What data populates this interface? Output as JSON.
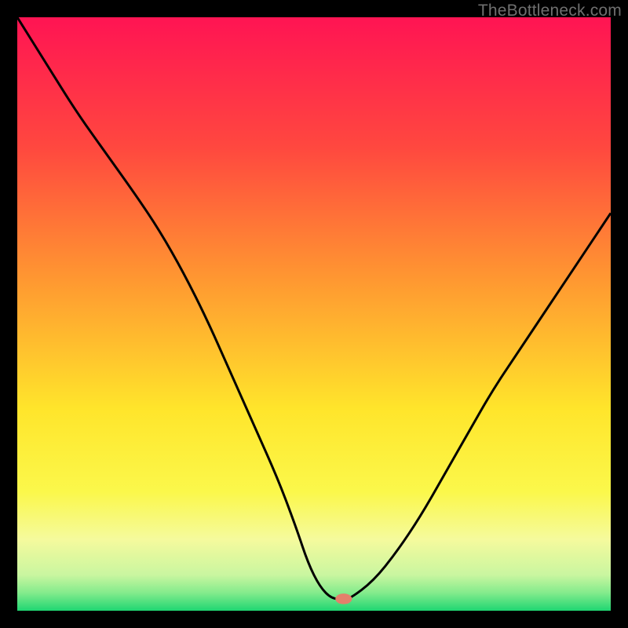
{
  "watermark": "TheBottleneck.com",
  "chart_data": {
    "type": "line",
    "title": "",
    "xlabel": "",
    "ylabel": "",
    "xlim": [
      0,
      100
    ],
    "ylim": [
      0,
      100
    ],
    "grid": false,
    "legend": false,
    "background_gradient": {
      "stops": [
        {
          "pct": 0,
          "color": "#ff1453"
        },
        {
          "pct": 22,
          "color": "#ff483f"
        },
        {
          "pct": 44,
          "color": "#ff9731"
        },
        {
          "pct": 66,
          "color": "#ffe52b"
        },
        {
          "pct": 80,
          "color": "#fbf84b"
        },
        {
          "pct": 88,
          "color": "#f5fa9d"
        },
        {
          "pct": 94,
          "color": "#c9f6a0"
        },
        {
          "pct": 97,
          "color": "#83eb8c"
        },
        {
          "pct": 100,
          "color": "#1fd672"
        }
      ]
    },
    "series": [
      {
        "name": "bottleneck-curve",
        "color": "#000000",
        "x": [
          0,
          5,
          10,
          15,
          20,
          24,
          28,
          32,
          36,
          40,
          44,
          47,
          49,
          51,
          53,
          55,
          56,
          60,
          64,
          68,
          72,
          76,
          80,
          84,
          88,
          92,
          96,
          100
        ],
        "y": [
          100,
          92,
          84,
          77,
          70,
          64,
          57,
          49,
          40,
          31,
          22,
          14,
          8,
          4,
          2,
          2,
          2,
          5,
          10,
          16,
          23,
          30,
          37,
          43,
          49,
          55,
          61,
          67
        ]
      }
    ],
    "marker": {
      "name": "optimal-point",
      "x": 55,
      "y": 2,
      "color": "#e4806b"
    }
  }
}
